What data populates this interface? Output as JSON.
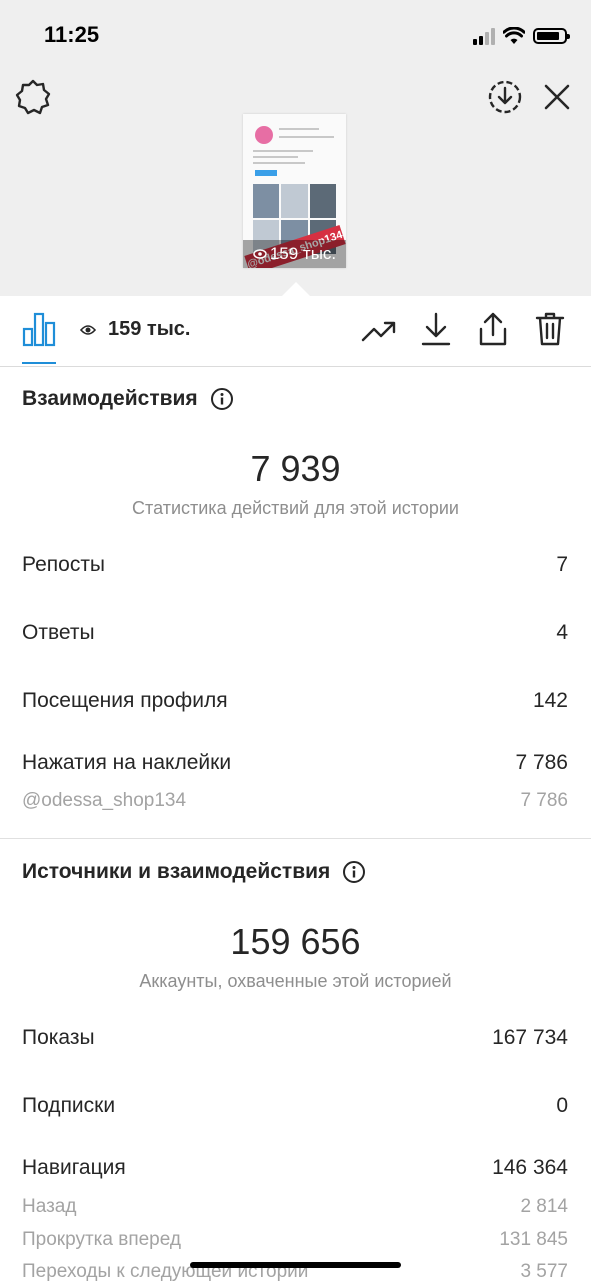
{
  "status_bar": {
    "time": "11:25"
  },
  "story_preview": {
    "sticker_text": "@odessa_shop134",
    "views_overlay": "159 тыс."
  },
  "toolbar": {
    "views_count": "159 тыс."
  },
  "interactions": {
    "title": "Взаимодействия",
    "total": "7 939",
    "subtitle": "Статистика действий для этой истории",
    "rows": [
      {
        "label": "Репосты",
        "value": "7"
      },
      {
        "label": "Ответы",
        "value": "4"
      },
      {
        "label": "Посещения профиля",
        "value": "142"
      },
      {
        "label": "Нажатия на наклейки",
        "value": "7 786"
      }
    ],
    "sub_rows": [
      {
        "label": "@odessa_shop134",
        "value": "7 786"
      }
    ]
  },
  "discovery": {
    "title": "Источники и взаимодействия",
    "total": "159 656",
    "subtitle": "Аккаунты, охваченные этой историей",
    "rows": [
      {
        "label": "Показы",
        "value": "167 734"
      },
      {
        "label": "Подписки",
        "value": "0"
      },
      {
        "label": "Навигация",
        "value": "146 364"
      }
    ],
    "sub_rows": [
      {
        "label": "Назад",
        "value": "2 814"
      },
      {
        "label": "Прокрутка вперед",
        "value": "131 845"
      },
      {
        "label": "Переходы к следующей истории",
        "value": "3 577"
      }
    ]
  },
  "colors": {
    "accent": "#1f8ed8",
    "text": "#262626",
    "muted": "#8e8e8e",
    "sticker": "#d63042"
  }
}
